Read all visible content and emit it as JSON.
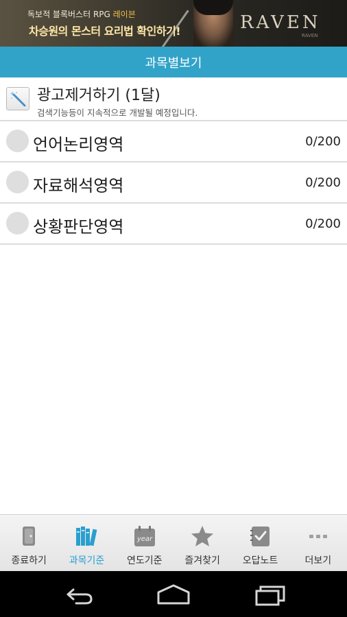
{
  "banner": {
    "line1_a": "독보적 블록버스터 RPG ",
    "line1_b": "레이븐",
    "line2": "차승원의 몬스터 요리법 확인하기!",
    "logo": "RAVEN",
    "logo_sub": "RAVEN"
  },
  "header": {
    "title": "과목별보기"
  },
  "ad_item": {
    "title": "광고제거하기 (1달)",
    "subtitle": "검색기능등이 지속적으로 개발될 예정입니다."
  },
  "subjects": [
    {
      "name": "언어논리영역",
      "progress": "0/200"
    },
    {
      "name": "자료해석영역",
      "progress": "0/200"
    },
    {
      "name": "상황판단영역",
      "progress": "0/200"
    }
  ],
  "tabs": [
    {
      "label": "종료하기",
      "icon": "exit-door-icon"
    },
    {
      "label": "과목기준",
      "icon": "books-icon",
      "active": true
    },
    {
      "label": "연도기준",
      "icon": "year-calendar-icon"
    },
    {
      "label": "즐겨찾기",
      "icon": "star-icon"
    },
    {
      "label": "오답노트",
      "icon": "notebook-check-icon"
    },
    {
      "label": "더보기",
      "icon": "more-dots-icon"
    }
  ],
  "colors": {
    "header": "#32a3c8",
    "active_tab": "#2a9fcf",
    "circle": "#dedede"
  }
}
